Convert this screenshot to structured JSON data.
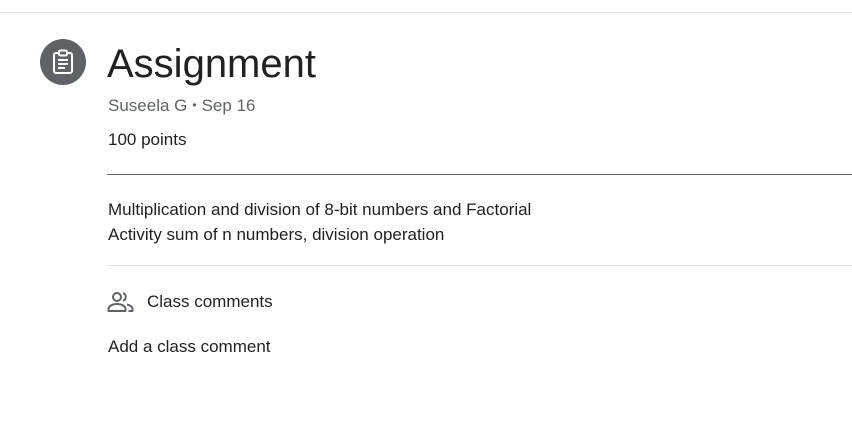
{
  "header": {
    "icon": "assignment-icon",
    "title": "Assignment",
    "author": "Suseela G",
    "separator": "•",
    "date": "Sep 16",
    "points": "100 points"
  },
  "description": {
    "line1": "Multiplication and division of 8-bit numbers and Factorial",
    "line2": "Activity sum of n numbers, division operation"
  },
  "comments": {
    "icon": "people-icon",
    "label": "Class comments",
    "add_label": "Add a class comment"
  },
  "colors": {
    "icon_bg": "#5f6368",
    "text": "#202124",
    "muted": "#5f6368",
    "divider": "#e0e0e0"
  }
}
